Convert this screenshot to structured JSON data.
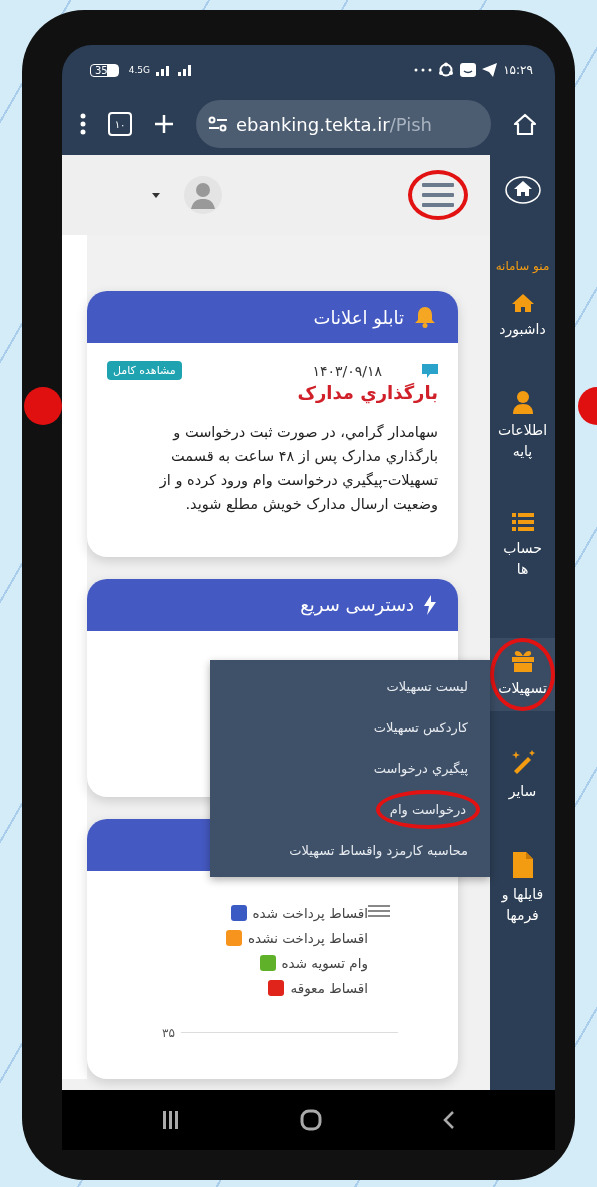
{
  "status_bar": {
    "battery": "35",
    "network": "4.5G",
    "time": "۱۵:۲۹"
  },
  "browser": {
    "tab_count": "۱۰",
    "url_host": "ebanking.tekta.ir",
    "url_path": "/Pish"
  },
  "header": {
    "menu_highlighted": true
  },
  "sidebar": {
    "title": "منو سامانه",
    "items": [
      {
        "label": "داشبورد",
        "selected": false,
        "highlighted": false
      },
      {
        "label": "اطلاعات پایه",
        "selected": false,
        "highlighted": false
      },
      {
        "label": "حساب ها",
        "selected": false,
        "highlighted": false
      },
      {
        "label": "تسهیلات",
        "selected": true,
        "highlighted": true
      },
      {
        "label": "سایر",
        "selected": false,
        "highlighted": false
      },
      {
        "label": "فایلها و فرمها",
        "selected": false,
        "highlighted": false
      }
    ]
  },
  "submenu": {
    "items": [
      {
        "label": "لیست تسهیلات",
        "highlighted": false
      },
      {
        "label": "کاردکس تسهیلات",
        "highlighted": false
      },
      {
        "label": "پیگیري درخواست",
        "highlighted": false
      },
      {
        "label": "درخواست وام",
        "highlighted": true
      },
      {
        "label": "محاسبه کارمزد واقساط تسهیلات",
        "highlighted": false
      }
    ]
  },
  "notice_board": {
    "title": "تابلو اعلانات",
    "date": "۱۴۰۳/۰۹/۱۸",
    "view_button": "مشاهده کامل",
    "heading": "بارگذاري مدارک",
    "body": "سهامدار گرامي، در صورت ثبت درخواست و بارگذاري مدارک پس از ۴۸ ساعت به قسمت تسهيلات-پيگيري درخواست وام ورود کرده و از وضعيت ارسال مدارک خويش مطلع شويد."
  },
  "quick_access": {
    "title": "دسترسی سریع"
  },
  "loans_chart": {
    "legend": [
      {
        "label": "اقساط پرداخت شده",
        "color": "#3b5bc4"
      },
      {
        "label": "اقساط پرداخت نشده",
        "color": "#f7941d"
      },
      {
        "label": "وام تسویه شده",
        "color": "#5fb12a"
      },
      {
        "label": "اقساط معوقه",
        "color": "#e0241b"
      }
    ],
    "axis_tick": "۳۵"
  }
}
